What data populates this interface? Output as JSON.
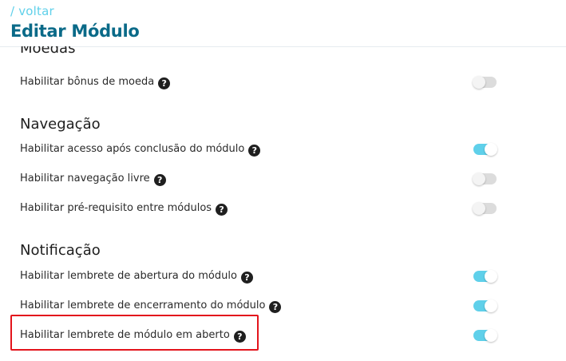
{
  "header": {
    "back_label": "/ voltar",
    "title": "Editar Módulo"
  },
  "sections": [
    {
      "title": "Moedas",
      "items": [
        {
          "label": "Habilitar bônus de moeda",
          "enabled": false
        }
      ]
    },
    {
      "title": "Navegação",
      "items": [
        {
          "label": "Habilitar acesso após conclusão do módulo",
          "enabled": true
        },
        {
          "label": "Habilitar navegação livre",
          "enabled": false
        },
        {
          "label": "Habilitar pré-requisito entre módulos",
          "enabled": false
        }
      ]
    },
    {
      "title": "Notificação",
      "items": [
        {
          "label": "Habilitar lembrete de abertura do módulo",
          "enabled": true
        },
        {
          "label": "Habilitar lembrete de encerramento do módulo",
          "enabled": true
        },
        {
          "label": "Habilitar lembrete de módulo em aberto",
          "enabled": true
        }
      ]
    }
  ],
  "help_glyph": "?",
  "icons": {
    "help": "question-circle-icon"
  },
  "colors": {
    "accent": "#5fd0ea",
    "title": "#0a6a88",
    "toggle_off": "#dcdcdc",
    "highlight": "#e3141c"
  }
}
